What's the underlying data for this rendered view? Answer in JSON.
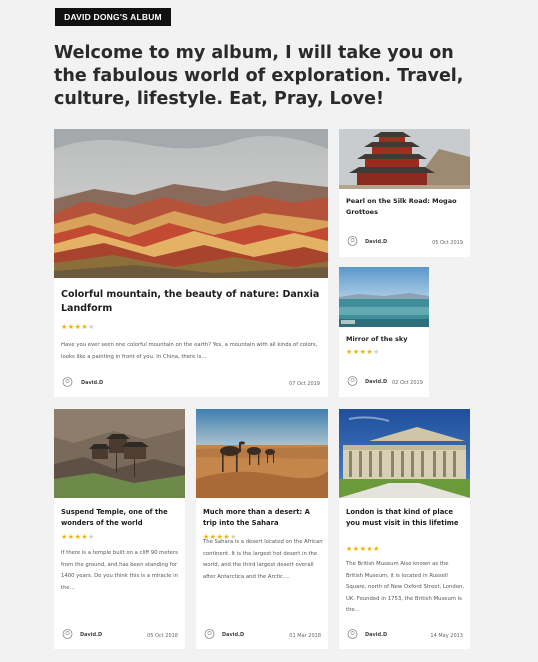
{
  "header": {
    "album_label": "DAVID DONG'S ALBUM",
    "headline": "Welcome to my album, I will take you on the fabulous world of exploration. Travel, culture, lifestyle. Eat, Pray, Love!"
  },
  "cards": [
    {
      "title": "Colorful mountain, the beauty of nature: Danxia Landform",
      "rating": 4,
      "excerpt": "Have you ever seen one colorful mountain on the earth? Yes, a mountain with all kinds of colors, looks like a painting in front of you. In China, there is...",
      "author": "David.D",
      "date": "07 Oct 2019",
      "image": "rainbow-mountains"
    },
    {
      "title": "Pearl on the Silk Road: Mogao Grottoes",
      "author": "David.D",
      "date": "05 Oct 2019",
      "image": "mogao-pagoda"
    },
    {
      "title": "Mirror of the sky",
      "rating": 4,
      "author": "David.D",
      "date": "02 Oct 2019",
      "image": "salt-lake"
    },
    {
      "title": "Suspend Temple, one of the wonders of the world",
      "rating": 4,
      "excerpt": "If there is a temple built on a cliff 90 meters from the ground, and has been standing for 1400 years. Do you think this is a miracle in the...",
      "author": "David.D",
      "date": "05 Oct 2018",
      "image": "hanging-temple"
    },
    {
      "title": "Much more than a desert: A trip into the Sahara",
      "rating": 4,
      "excerpt": "The Sahara is a desert located on the African continent. It is the largest hot desert in the world, and the third largest desert overall after Antarctica and the Arctic....",
      "author": "David.D",
      "date": "01 Mar 2018",
      "image": "camels-desert"
    },
    {
      "title": "London is that kind of place you must visit in this lifetime",
      "rating": 5,
      "excerpt": "The British Museum Also known as the British Museum, it is located in Russell Square, north of New Oxford Street, London, UK. Founded in 1753, the British Museum is the...",
      "author": "David.D",
      "date": "14 May 2013",
      "image": "british-museum"
    }
  ]
}
